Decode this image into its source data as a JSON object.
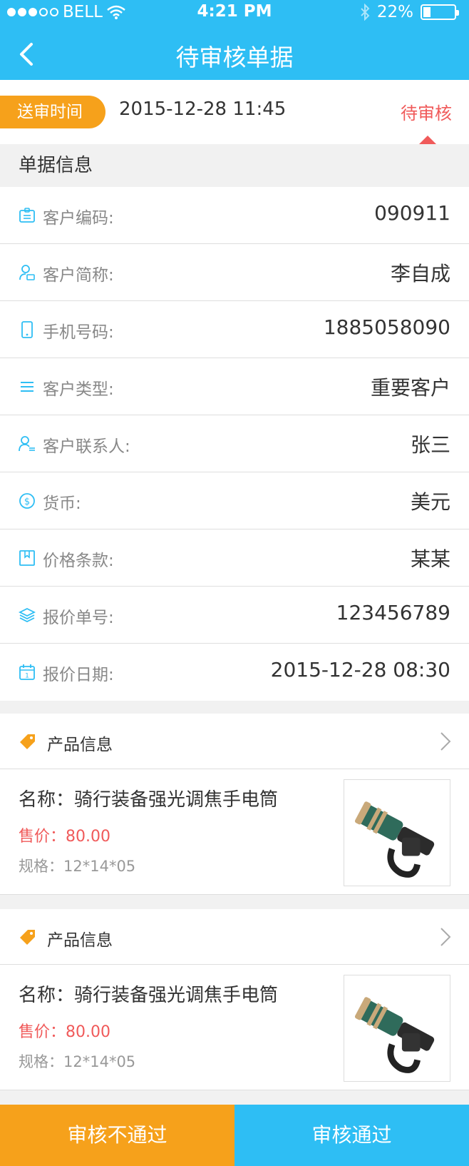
{
  "status_bar": {
    "carrier": "BELL",
    "time": "4:21 PM",
    "battery": "22%",
    "signal_dots_filled": 3,
    "signal_dots_total": 5
  },
  "nav": {
    "title": "待审核单据"
  },
  "submit": {
    "label": "送审时间",
    "time": "2015-12-28  11:45",
    "status": "待审核"
  },
  "section": {
    "title": "单据信息"
  },
  "info": [
    {
      "icon": "id-card-icon",
      "label": "客户编码:",
      "value": "090911"
    },
    {
      "icon": "user-card-icon",
      "label": "客户简称:",
      "value": "李自成"
    },
    {
      "icon": "phone-icon",
      "label": "手机号码:",
      "value": "1885058090"
    },
    {
      "icon": "list-icon",
      "label": "客户类型:",
      "value": "重要客户"
    },
    {
      "icon": "contact-icon",
      "label": "客户联系人:",
      "value": "张三"
    },
    {
      "icon": "dollar-icon",
      "label": "货币:",
      "value": "美元"
    },
    {
      "icon": "bookmark-icon",
      "label": "价格条款:",
      "value": "某某"
    },
    {
      "icon": "layers-icon",
      "label": "报价单号:",
      "value": "123456789"
    },
    {
      "icon": "calendar-icon",
      "label": "报价日期:",
      "value": "2015-12-28  08:30"
    }
  ],
  "products": [
    {
      "header": "产品信息",
      "name": "名称：骑行装备强光调焦手电筒",
      "price": "售价：80.00",
      "spec": "规格：12*14*05"
    },
    {
      "header": "产品信息",
      "name": "名称：骑行装备强光调焦手电筒",
      "price": "售价：80.00",
      "spec": "规格：12*14*05"
    }
  ],
  "actions": {
    "reject": "审核不通过",
    "approve": "审核通过"
  },
  "colors": {
    "primary": "#2ebef4",
    "accent": "#f6a11b",
    "warning": "#f05a5a"
  }
}
